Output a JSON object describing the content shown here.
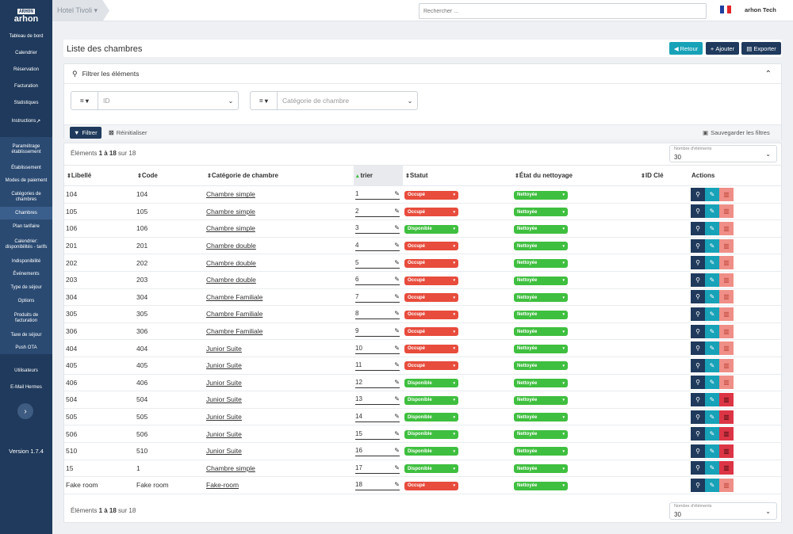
{
  "colors": {
    "sidebar": "#1f3a5c",
    "teal": "#17a2b8",
    "navy": "#1f3a5c",
    "red": "#e74c3c",
    "green": "#3fbf3f",
    "delete": "#dc3545",
    "delete_faded": "#ef8f87"
  },
  "logo": {
    "top": "ARHON",
    "bottom": "arhon"
  },
  "sidebar": {
    "items": [
      {
        "label": "Tableau de bord"
      },
      {
        "label": "Calendrier"
      },
      {
        "label": "Réservation"
      },
      {
        "label": "Facturation"
      },
      {
        "label": "Statistiques"
      },
      {
        "label": "Instructions"
      },
      {
        "label": "Paramétrage établissement"
      },
      {
        "label": "Établissement"
      },
      {
        "label": "Modes de paiement"
      },
      {
        "label": "Catégories de chambres"
      },
      {
        "label": "Chambres"
      },
      {
        "label": "Plan tarifaire"
      },
      {
        "label": "Calendrier: disponibilités - tarifs"
      },
      {
        "label": "Indisponibilité"
      },
      {
        "label": "Événements"
      },
      {
        "label": "Type de séjour"
      },
      {
        "label": "Options"
      },
      {
        "label": "Produits de facturation"
      },
      {
        "label": "Taxe de séjour"
      },
      {
        "label": "Push OTA"
      },
      {
        "label": "Utilisateurs"
      },
      {
        "label": "E-Mail Hermes"
      }
    ],
    "collapse_icon": "chevron-right-icon",
    "version": "Version 1.7.4"
  },
  "topbar": {
    "hotel": "Hotel Tivoli",
    "search_placeholder": "Rechercher ...",
    "user": "arhon Tech",
    "flag": "france-flag-icon"
  },
  "page": {
    "title": "Liste des chambres",
    "back": "Retour",
    "add": "Ajouter",
    "export": "Exporter"
  },
  "filter": {
    "header": "Filtrer les éléments",
    "op1": "=",
    "f1_placeholder": "ID",
    "op2": "=",
    "f2_placeholder": "Catégorie de chambre",
    "apply": "Filtrer",
    "reset": "Réinitialiser",
    "save": "Sauvegarder les filtres"
  },
  "list": {
    "count_prefix": "Éléments ",
    "count_range": "1 à 18",
    "count_suffix": " sur 18",
    "per_page_label": "Nombre d'éléments",
    "per_page": "30",
    "columns": [
      "Libellé",
      "Code",
      "Catégorie de chambre",
      "trier",
      "Statut",
      "État du nettoyage",
      "ID Clé",
      "Actions"
    ],
    "rows": [
      {
        "label": "104",
        "code": "104",
        "cat": "Chambre simple",
        "trier": "1",
        "status": "Occupé",
        "clean": "Nettoyée",
        "del": false
      },
      {
        "label": "105",
        "code": "105",
        "cat": "Chambre simple",
        "trier": "2",
        "status": "Occupé",
        "clean": "Nettoyée",
        "del": false
      },
      {
        "label": "106",
        "code": "106",
        "cat": "Chambre simple",
        "trier": "3",
        "status": "Disponible",
        "clean": "Nettoyée",
        "del": false
      },
      {
        "label": "201",
        "code": "201",
        "cat": "Chambre double",
        "trier": "4",
        "status": "Occupé",
        "clean": "Nettoyée",
        "del": false
      },
      {
        "label": "202",
        "code": "202",
        "cat": "Chambre double",
        "trier": "5",
        "status": "Occupé",
        "clean": "Nettoyée",
        "del": false
      },
      {
        "label": "203",
        "code": "203",
        "cat": "Chambre double",
        "trier": "6",
        "status": "Occupé",
        "clean": "Nettoyée",
        "del": false
      },
      {
        "label": "304",
        "code": "304",
        "cat": "Chambre Familiale",
        "trier": "7",
        "status": "Occupé",
        "clean": "Nettoyée",
        "del": false
      },
      {
        "label": "305",
        "code": "305",
        "cat": "Chambre Familiale",
        "trier": "8",
        "status": "Occupé",
        "clean": "Nettoyée",
        "del": false
      },
      {
        "label": "306",
        "code": "306",
        "cat": "Chambre Familiale",
        "trier": "9",
        "status": "Occupé",
        "clean": "Nettoyée",
        "del": false
      },
      {
        "label": "404",
        "code": "404",
        "cat": "Junior Suite",
        "trier": "10",
        "status": "Occupé",
        "clean": "Nettoyée",
        "del": false
      },
      {
        "label": "405",
        "code": "405",
        "cat": "Junior Suite",
        "trier": "11",
        "status": "Occupé",
        "clean": "Nettoyée",
        "del": false
      },
      {
        "label": "406",
        "code": "406",
        "cat": "Junior Suite",
        "trier": "12",
        "status": "Disponible",
        "clean": "Nettoyée",
        "del": false
      },
      {
        "label": "504",
        "code": "504",
        "cat": "Junior Suite",
        "trier": "13",
        "status": "Disponible",
        "clean": "Nettoyée",
        "del": true
      },
      {
        "label": "505",
        "code": "505",
        "cat": "Junior Suite",
        "trier": "14",
        "status": "Disponible",
        "clean": "Nettoyée",
        "del": true
      },
      {
        "label": "506",
        "code": "506",
        "cat": "Junior Suite",
        "trier": "15",
        "status": "Disponible",
        "clean": "Nettoyée",
        "del": true
      },
      {
        "label": "510",
        "code": "510",
        "cat": "Junior Suite",
        "trier": "16",
        "status": "Disponible",
        "clean": "Nettoyée",
        "del": true
      },
      {
        "label": "15",
        "code": "1",
        "cat": "Chambre simple",
        "trier": "17",
        "status": "Disponible",
        "clean": "Nettoyée",
        "del": true
      },
      {
        "label": "Fake room",
        "code": "Fake room",
        "cat": "Fake-room",
        "trier": "18",
        "status": "Occupé",
        "clean": "Nettoyée",
        "del": false
      }
    ]
  }
}
